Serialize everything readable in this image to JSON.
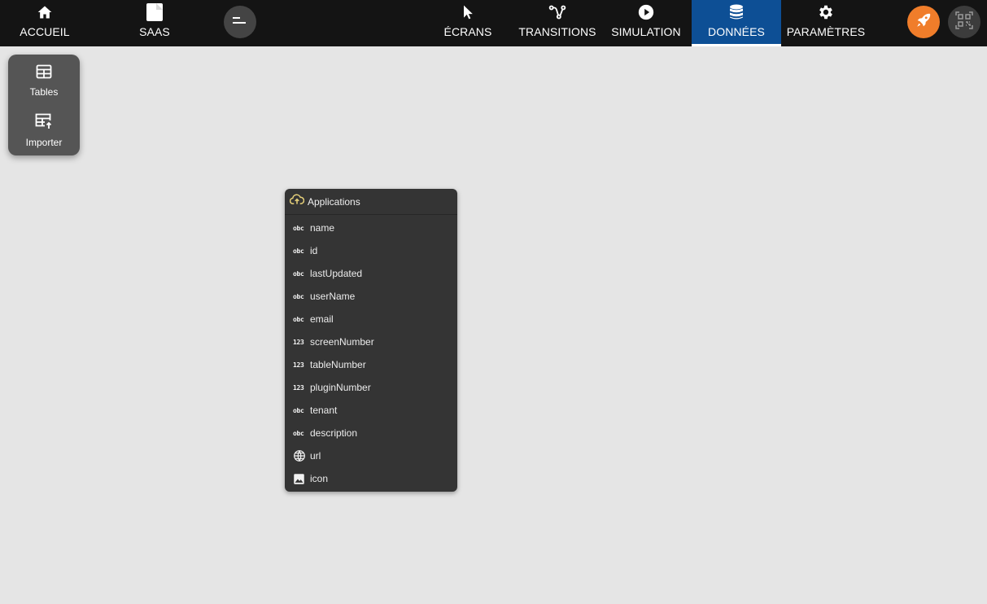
{
  "nav": {
    "home": {
      "label": "ACCUEIL",
      "icon": "home-icon"
    },
    "saas": {
      "label": "SAAS",
      "icon": "document-icon"
    },
    "screens": {
      "label": "ÉCRANS",
      "icon": "pointer-icon"
    },
    "transitions": {
      "label": "TRANSITIONS",
      "icon": "flow-icon"
    },
    "simulation": {
      "label": "SIMULATION",
      "icon": "play-icon"
    },
    "data": {
      "label": "DONNÉES",
      "icon": "database-icon"
    },
    "settings": {
      "label": "PARAMÈTRES",
      "icon": "gear-icon"
    }
  },
  "side_panel": {
    "tables_label": "Tables",
    "import_label": "Importer"
  },
  "table": {
    "title": "Applications",
    "fields": [
      {
        "type_label": "obc",
        "name": "name"
      },
      {
        "type_label": "obc",
        "name": "id"
      },
      {
        "type_label": "obc",
        "name": "lastUpdated"
      },
      {
        "type_label": "obc",
        "name": "userName"
      },
      {
        "type_label": "obc",
        "name": "email"
      },
      {
        "type_label": "123",
        "name": "screenNumber"
      },
      {
        "type_label": "123",
        "name": "tableNumber"
      },
      {
        "type_label": "123",
        "name": "pluginNumber"
      },
      {
        "type_label": "obc",
        "name": "tenant"
      },
      {
        "type_label": "obc",
        "name": "description"
      },
      {
        "type_label": "",
        "icon": "globe-icon",
        "name": "url"
      },
      {
        "type_label": "",
        "icon": "image-icon",
        "name": "icon"
      }
    ]
  },
  "colors": {
    "topbar": "#141414",
    "active_tab": "#0d4f95",
    "rocket_button": "#f07d2a",
    "canvas": "#e5e5e5",
    "card": "#343434",
    "cloud_icon": "#e8d27a"
  }
}
